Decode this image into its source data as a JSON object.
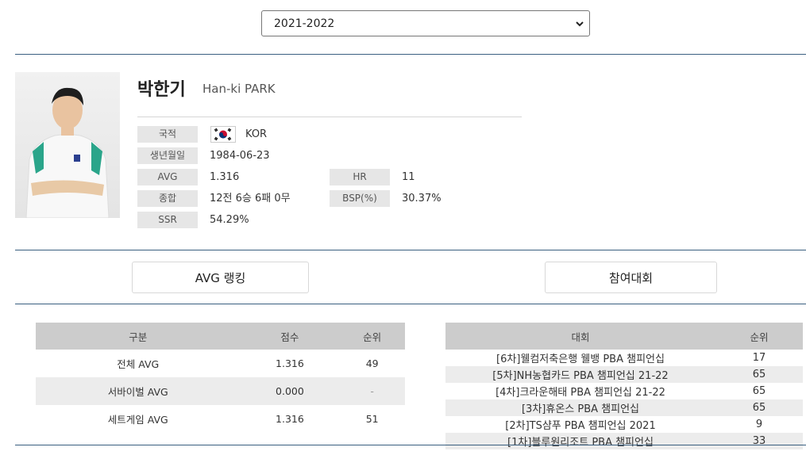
{
  "season": {
    "selected": "2021-2022"
  },
  "player": {
    "name_ko": "박한기",
    "name_en": "Han-ki PARK",
    "fields": {
      "nationality_label": "국적",
      "nationality_value": "KOR",
      "birth_label": "생년월일",
      "birth_value": "1984-06-23",
      "avg_label": "AVG",
      "avg_value": "1.316",
      "hr_label": "HR",
      "hr_value": "11",
      "record_label": "종합",
      "record_value": "12전 6승 6패 0무",
      "bsp_label": "BSP(%)",
      "bsp_value": "30.37%",
      "ssr_label": "SSR",
      "ssr_value": "54.29%"
    }
  },
  "tabs": {
    "avg_ranking": "AVG 랭킹",
    "tournaments": "참여대회"
  },
  "avg_table": {
    "headers": [
      "구분",
      "점수",
      "순위"
    ],
    "rows": [
      [
        "전체 AVG",
        "1.316",
        "49"
      ],
      [
        "서바이벌 AVG",
        "0.000",
        "-"
      ],
      [
        "세트게임 AVG",
        "1.316",
        "51"
      ]
    ]
  },
  "tournament_table": {
    "headers": [
      "대회",
      "순위"
    ],
    "rows": [
      [
        "[6차]웰컴저축은행 웰뱅 PBA 챔피언십",
        "17"
      ],
      [
        "[5차]NH농협카드 PBA 챔피언십 21-22",
        "65"
      ],
      [
        "[4차]크라운해태 PBA 챔피언십 21-22",
        "65"
      ],
      [
        "[3차]휴온스 PBA 챔피언십",
        "65"
      ],
      [
        "[2차]TS샴푸 PBA 챔피언십 2021",
        "9"
      ],
      [
        "[1차]블루원리조트 PBA 챔피언십",
        "33"
      ]
    ]
  },
  "icons": {
    "flag": "korea-flag-icon",
    "dropdown": "chevron-down-icon"
  }
}
